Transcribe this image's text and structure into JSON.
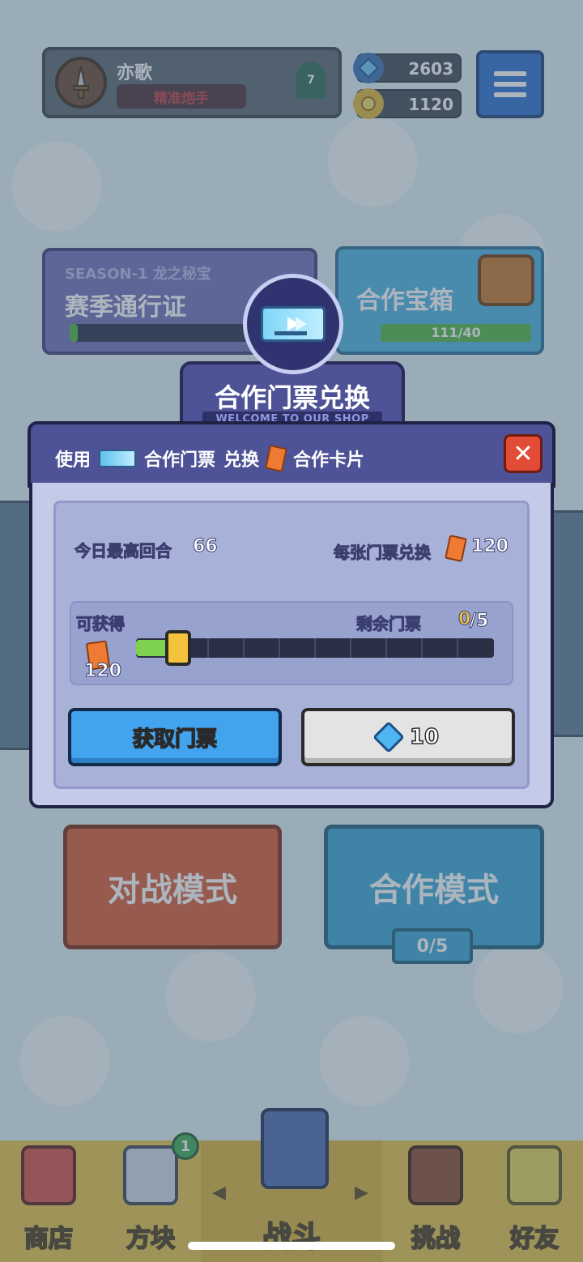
{
  "header": {
    "username": "亦歌",
    "title_badge": "精准炮手",
    "rank": "7",
    "gems": "2603",
    "coins": "1120"
  },
  "season": {
    "subtitle": "SEASON-1 龙之秘宝",
    "title": "赛季通行证"
  },
  "coop_chest": {
    "title": "合作宝箱",
    "progress_text": "111/40"
  },
  "modal": {
    "title": "合作门票兑换",
    "subtitle": "WELCOME TO OUR SHOP",
    "desc_use": "使用",
    "desc_ticket": "合作门票",
    "desc_exchange": "兑换",
    "desc_card": "合作卡片",
    "close_label": "✕",
    "today_best_label": "今日最高回合",
    "today_best_value": "66",
    "per_ticket_label": "每张门票兑换",
    "per_ticket_value": "120",
    "obtainable_label": "可获得",
    "obtainable_value": "120",
    "remaining_label": "剩余门票",
    "remaining_current": "0",
    "remaining_total": "/5",
    "slider_position": 0.1,
    "get_ticket_button": "获取门票",
    "price_button": "10"
  },
  "modes": {
    "battle": "对战模式",
    "coop": "合作模式",
    "coop_count": "0/5"
  },
  "nav": {
    "shop": "商店",
    "blocks": "方块",
    "fight": "战斗",
    "challenge": "挑战",
    "friends": "好友",
    "blocks_badge": "1"
  },
  "colors": {
    "primary_blue": "#42a3ee",
    "battle_red": "#d95a33",
    "coop_blue": "#3aa7d6",
    "modal_purple": "#4e5296"
  }
}
